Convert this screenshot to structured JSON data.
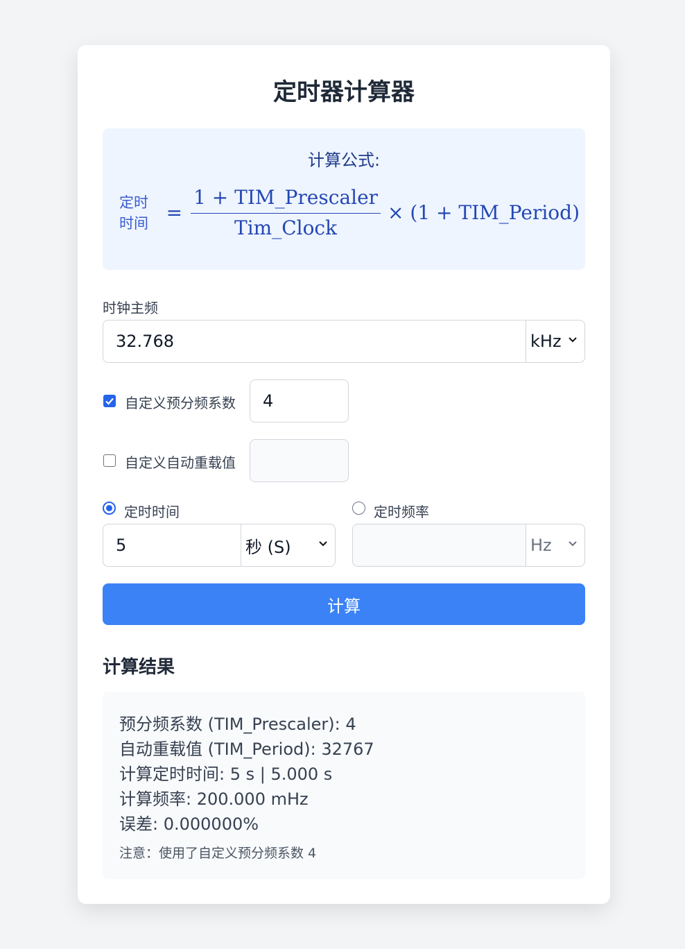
{
  "title": "定时器计算器",
  "formula": {
    "heading": "计算公式:",
    "lhs": "定时时间",
    "numerator": "1 + TIM_Prescaler",
    "denominator": "Tim_Clock",
    "times_part": "× (1 + TIM_Period)"
  },
  "clock": {
    "label": "时钟主频",
    "value": "32.768",
    "unit": "kHz"
  },
  "prescaler": {
    "checked": true,
    "label": "自定义预分频系数",
    "value": "4"
  },
  "reload": {
    "checked": false,
    "label": "自定义自动重载值",
    "value": ""
  },
  "time_mode": {
    "selected": true,
    "label": "定时时间",
    "value": "5",
    "unit": "秒 (S)"
  },
  "freq_mode": {
    "selected": false,
    "label": "定时频率",
    "value": "",
    "unit": "Hz"
  },
  "calc_button": "计算",
  "results": {
    "title": "计算结果",
    "lines": [
      "预分频系数 (TIM_Prescaler): 4",
      "自动重载值 (TIM_Period): 32767",
      "计算定时时间: 5 s | 5.000 s",
      "计算频率: 200.000 mHz",
      "误差: 0.000000%"
    ],
    "note": "注意：使用了自定义预分频系数 4"
  },
  "colors": {
    "accent": "#3b82f6",
    "checkbox": "#2563eb",
    "formula_bg": "#eef5ff",
    "formula_text": "#2447b3"
  }
}
